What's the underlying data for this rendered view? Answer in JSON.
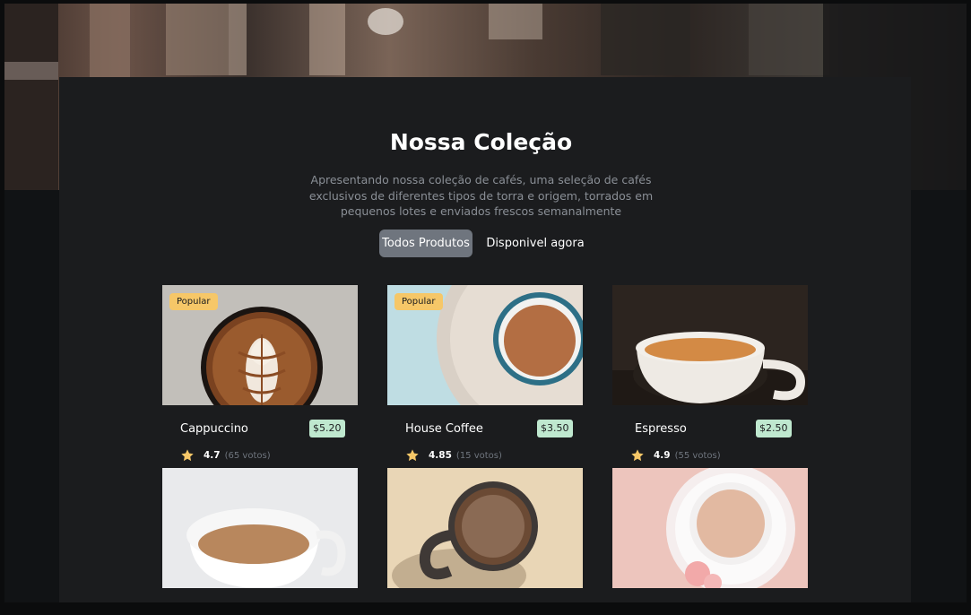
{
  "collection": {
    "title": "Nossa Coleção",
    "subtitle": "Apresentando nossa coleção de cafés, uma seleção de cafés exclusivos de diferentes tipos de torra e origem, torrados em pequenos lotes e enviados frescos semanalmente"
  },
  "tabs": [
    {
      "label": "Todos Produtos",
      "active": true
    },
    {
      "label": "Disponivel agora",
      "active": false
    }
  ],
  "products": [
    {
      "name": "Cappuccino",
      "price": "$5.20",
      "badge": "Popular",
      "rating": "4.7",
      "votes": "(65 votos)"
    },
    {
      "name": "House Coffee",
      "price": "$3.50",
      "badge": "Popular",
      "rating": "4.85",
      "votes": "(15 votos)"
    },
    {
      "name": "Espresso",
      "price": "$2.50",
      "badge": "",
      "rating": "4.9",
      "votes": "(55 votos)"
    }
  ],
  "icons": {
    "rating": "star-icon"
  },
  "colors": {
    "badge": "#f6c768",
    "price_tag": "#bfe8cf",
    "star": "#f6c768",
    "active_tab": "#6f757e",
    "panel": "#1b1c1e"
  }
}
